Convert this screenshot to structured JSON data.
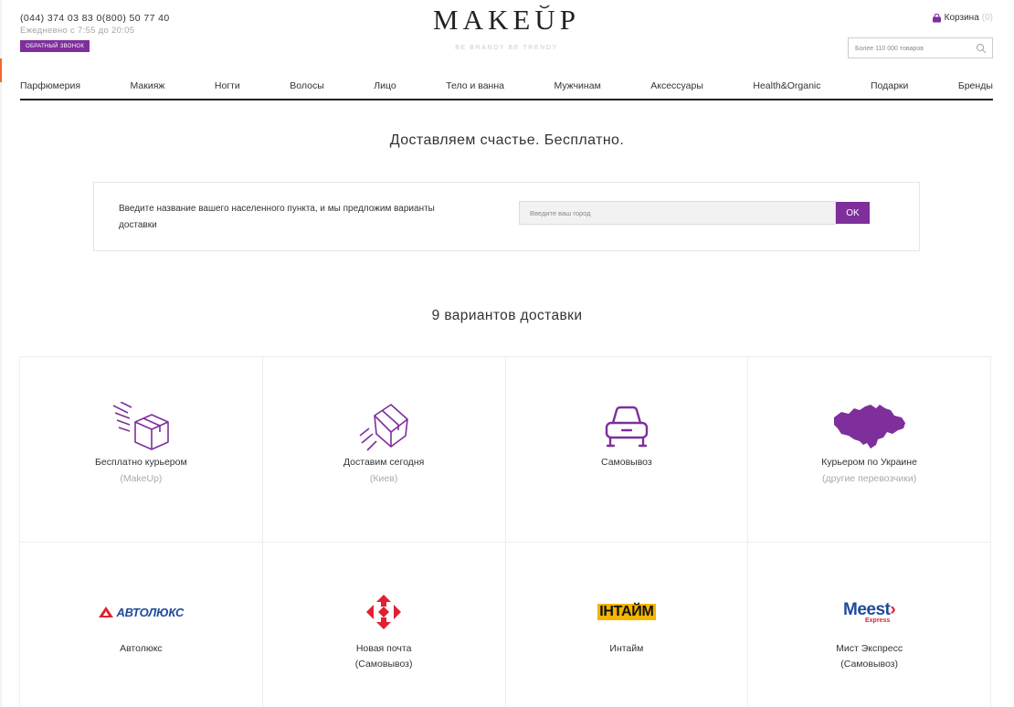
{
  "header": {
    "phones": "(044) 374 03 83  0(800) 50 77 40",
    "hours": "Ежедневно с 7:55 до 20:05",
    "callback_label": "ОБРАТНЫЙ ЗВОНОК",
    "logo": "MAKEUP",
    "tagline": "BE BRANDY  BE TRENDY",
    "cart_label": "Корзина",
    "cart_count": "(0)",
    "search_placeholder": "Более 110 000 товаров"
  },
  "nav": [
    "Парфюмерия",
    "Макияж",
    "Ногти",
    "Волосы",
    "Лицо",
    "Тело и ванна",
    "Мужчинам",
    "Аксессуары",
    "Health&Organic",
    "Подарки",
    "Бренды"
  ],
  "hero": {
    "title": "Доставляем счастье. Бесплатно.",
    "city_prompt": "Введите название вашего населенного пункта, и мы предложим варианты доставки",
    "city_placeholder": "Введите ваш город",
    "ok_label": "OK"
  },
  "delivery": {
    "title": "9 вариантов доставки",
    "options": [
      {
        "label": "Бесплатно курьером",
        "sub": "(MakeUp)",
        "icon": "box-courier-icon"
      },
      {
        "label": "Доставим сегодня",
        "sub": "(Киев)",
        "icon": "flying-box-icon"
      },
      {
        "label": "Самовывоз",
        "sub": "",
        "icon": "car-icon"
      },
      {
        "label": "Курьером по Украине",
        "sub": "(другие перевозчики)",
        "icon": "ukraine-map-icon"
      },
      {
        "label": "Автолюкс",
        "sub": "",
        "icon": "autolux-logo",
        "logo_text": "АВТОЛЮКС"
      },
      {
        "label": "Новая почта",
        "sub": "(Самовывоз)",
        "icon": "nova-poshta-logo"
      },
      {
        "label": "Интайм",
        "sub": "",
        "icon": "intime-logo",
        "logo_text": "ІНТАЙМ"
      },
      {
        "label": "Мист Экспресс",
        "sub": "(Самовывоз)",
        "icon": "meest-logo",
        "logo_text": "Meest",
        "logo_sub": "Express"
      }
    ]
  },
  "colors": {
    "accent": "#7e2f9c",
    "text": "#333333",
    "muted": "#aaaaaa"
  }
}
